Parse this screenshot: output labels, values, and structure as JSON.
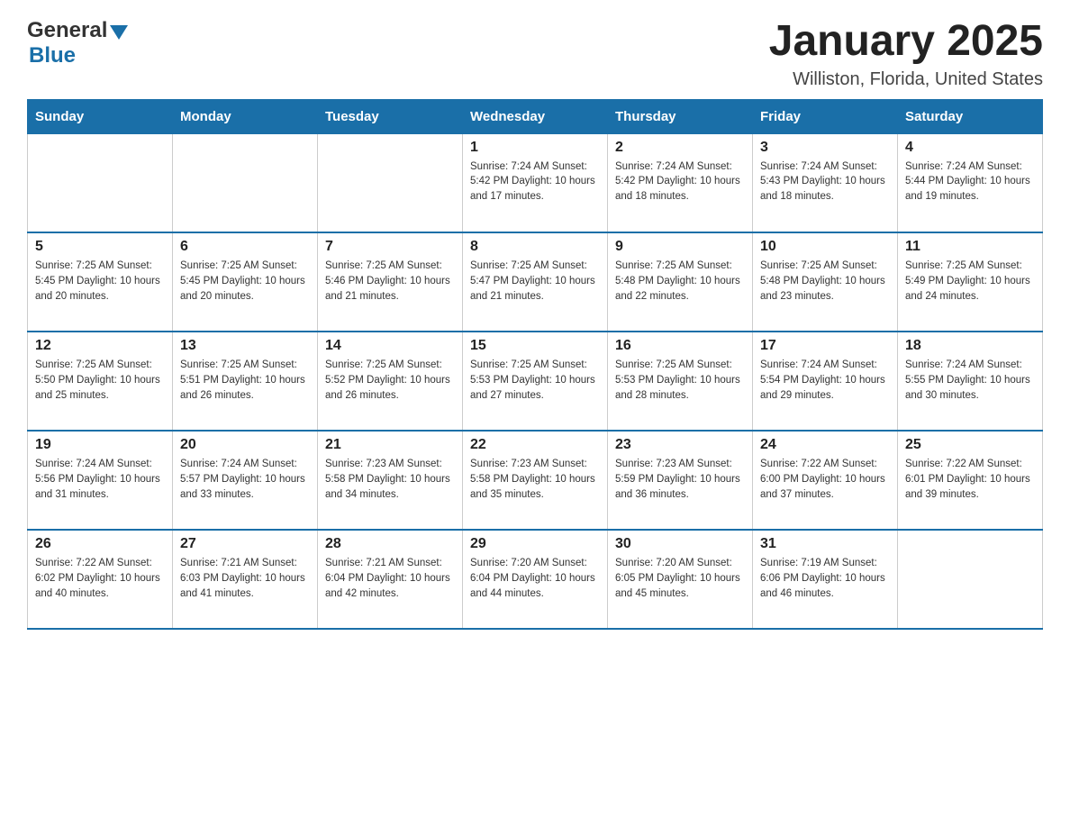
{
  "logo": {
    "text_general": "General",
    "text_blue": "Blue"
  },
  "header": {
    "month_title": "January 2025",
    "location": "Williston, Florida, United States"
  },
  "days_of_week": [
    "Sunday",
    "Monday",
    "Tuesday",
    "Wednesday",
    "Thursday",
    "Friday",
    "Saturday"
  ],
  "weeks": [
    [
      {
        "day": "",
        "info": ""
      },
      {
        "day": "",
        "info": ""
      },
      {
        "day": "",
        "info": ""
      },
      {
        "day": "1",
        "info": "Sunrise: 7:24 AM\nSunset: 5:42 PM\nDaylight: 10 hours\nand 17 minutes."
      },
      {
        "day": "2",
        "info": "Sunrise: 7:24 AM\nSunset: 5:42 PM\nDaylight: 10 hours\nand 18 minutes."
      },
      {
        "day": "3",
        "info": "Sunrise: 7:24 AM\nSunset: 5:43 PM\nDaylight: 10 hours\nand 18 minutes."
      },
      {
        "day": "4",
        "info": "Sunrise: 7:24 AM\nSunset: 5:44 PM\nDaylight: 10 hours\nand 19 minutes."
      }
    ],
    [
      {
        "day": "5",
        "info": "Sunrise: 7:25 AM\nSunset: 5:45 PM\nDaylight: 10 hours\nand 20 minutes."
      },
      {
        "day": "6",
        "info": "Sunrise: 7:25 AM\nSunset: 5:45 PM\nDaylight: 10 hours\nand 20 minutes."
      },
      {
        "day": "7",
        "info": "Sunrise: 7:25 AM\nSunset: 5:46 PM\nDaylight: 10 hours\nand 21 minutes."
      },
      {
        "day": "8",
        "info": "Sunrise: 7:25 AM\nSunset: 5:47 PM\nDaylight: 10 hours\nand 21 minutes."
      },
      {
        "day": "9",
        "info": "Sunrise: 7:25 AM\nSunset: 5:48 PM\nDaylight: 10 hours\nand 22 minutes."
      },
      {
        "day": "10",
        "info": "Sunrise: 7:25 AM\nSunset: 5:48 PM\nDaylight: 10 hours\nand 23 minutes."
      },
      {
        "day": "11",
        "info": "Sunrise: 7:25 AM\nSunset: 5:49 PM\nDaylight: 10 hours\nand 24 minutes."
      }
    ],
    [
      {
        "day": "12",
        "info": "Sunrise: 7:25 AM\nSunset: 5:50 PM\nDaylight: 10 hours\nand 25 minutes."
      },
      {
        "day": "13",
        "info": "Sunrise: 7:25 AM\nSunset: 5:51 PM\nDaylight: 10 hours\nand 26 minutes."
      },
      {
        "day": "14",
        "info": "Sunrise: 7:25 AM\nSunset: 5:52 PM\nDaylight: 10 hours\nand 26 minutes."
      },
      {
        "day": "15",
        "info": "Sunrise: 7:25 AM\nSunset: 5:53 PM\nDaylight: 10 hours\nand 27 minutes."
      },
      {
        "day": "16",
        "info": "Sunrise: 7:25 AM\nSunset: 5:53 PM\nDaylight: 10 hours\nand 28 minutes."
      },
      {
        "day": "17",
        "info": "Sunrise: 7:24 AM\nSunset: 5:54 PM\nDaylight: 10 hours\nand 29 minutes."
      },
      {
        "day": "18",
        "info": "Sunrise: 7:24 AM\nSunset: 5:55 PM\nDaylight: 10 hours\nand 30 minutes."
      }
    ],
    [
      {
        "day": "19",
        "info": "Sunrise: 7:24 AM\nSunset: 5:56 PM\nDaylight: 10 hours\nand 31 minutes."
      },
      {
        "day": "20",
        "info": "Sunrise: 7:24 AM\nSunset: 5:57 PM\nDaylight: 10 hours\nand 33 minutes."
      },
      {
        "day": "21",
        "info": "Sunrise: 7:23 AM\nSunset: 5:58 PM\nDaylight: 10 hours\nand 34 minutes."
      },
      {
        "day": "22",
        "info": "Sunrise: 7:23 AM\nSunset: 5:58 PM\nDaylight: 10 hours\nand 35 minutes."
      },
      {
        "day": "23",
        "info": "Sunrise: 7:23 AM\nSunset: 5:59 PM\nDaylight: 10 hours\nand 36 minutes."
      },
      {
        "day": "24",
        "info": "Sunrise: 7:22 AM\nSunset: 6:00 PM\nDaylight: 10 hours\nand 37 minutes."
      },
      {
        "day": "25",
        "info": "Sunrise: 7:22 AM\nSunset: 6:01 PM\nDaylight: 10 hours\nand 39 minutes."
      }
    ],
    [
      {
        "day": "26",
        "info": "Sunrise: 7:22 AM\nSunset: 6:02 PM\nDaylight: 10 hours\nand 40 minutes."
      },
      {
        "day": "27",
        "info": "Sunrise: 7:21 AM\nSunset: 6:03 PM\nDaylight: 10 hours\nand 41 minutes."
      },
      {
        "day": "28",
        "info": "Sunrise: 7:21 AM\nSunset: 6:04 PM\nDaylight: 10 hours\nand 42 minutes."
      },
      {
        "day": "29",
        "info": "Sunrise: 7:20 AM\nSunset: 6:04 PM\nDaylight: 10 hours\nand 44 minutes."
      },
      {
        "day": "30",
        "info": "Sunrise: 7:20 AM\nSunset: 6:05 PM\nDaylight: 10 hours\nand 45 minutes."
      },
      {
        "day": "31",
        "info": "Sunrise: 7:19 AM\nSunset: 6:06 PM\nDaylight: 10 hours\nand 46 minutes."
      },
      {
        "day": "",
        "info": ""
      }
    ]
  ]
}
